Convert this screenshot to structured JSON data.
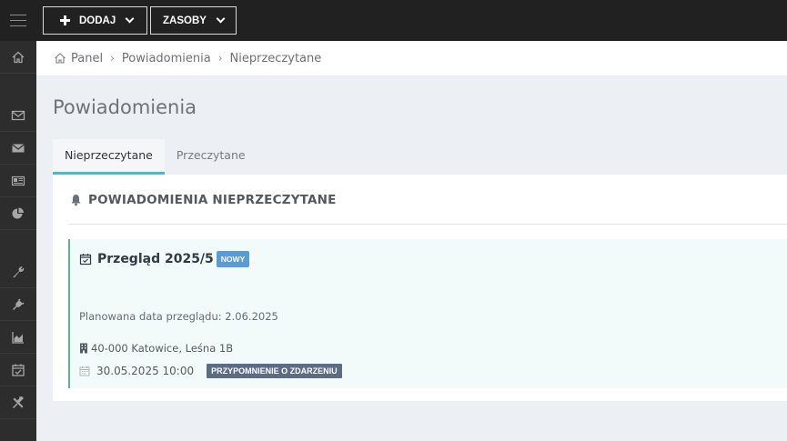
{
  "topbar": {
    "add_button": "DODAJ",
    "resources_button": "ZASOBY"
  },
  "sidebar": {
    "items": [
      "home-icon",
      "envelope-outline-icon",
      "envelope-icon",
      "newspaper-icon",
      "pie-chart-icon",
      "wrench-icon",
      "plug-icon",
      "area-chart-icon",
      "calendar-check-icon",
      "tools-icon"
    ]
  },
  "breadcrumb": {
    "items": [
      "Panel",
      "Powiadomienia",
      "Nieprzeczytane"
    ]
  },
  "page": {
    "title": "Powiadomienia"
  },
  "tabs": [
    {
      "label": "Nieprzeczytane",
      "active": true
    },
    {
      "label": "Przeczytane",
      "active": false
    }
  ],
  "panel": {
    "heading": "POWIADOMIENIA NIEPRZECZYTANE"
  },
  "notification": {
    "title": "Przegląd 2025/5",
    "badge": "NOWY",
    "planned": "Planowana data przeglądu: 2.06.2025",
    "address": "40-000 Katowice, Leśna 1B",
    "datetime": "30.05.2025 10:00",
    "tag": "PRZYPOMNIENIE O ZDARZENIU"
  },
  "colors": {
    "topbar": "#212121",
    "sidebar": "#2d2d2d",
    "tab_accent": "#3dbdd8",
    "badge_new": "#5b9bd5",
    "badge_reminder": "#5b6c84",
    "notification_border": "#5cb38e"
  }
}
